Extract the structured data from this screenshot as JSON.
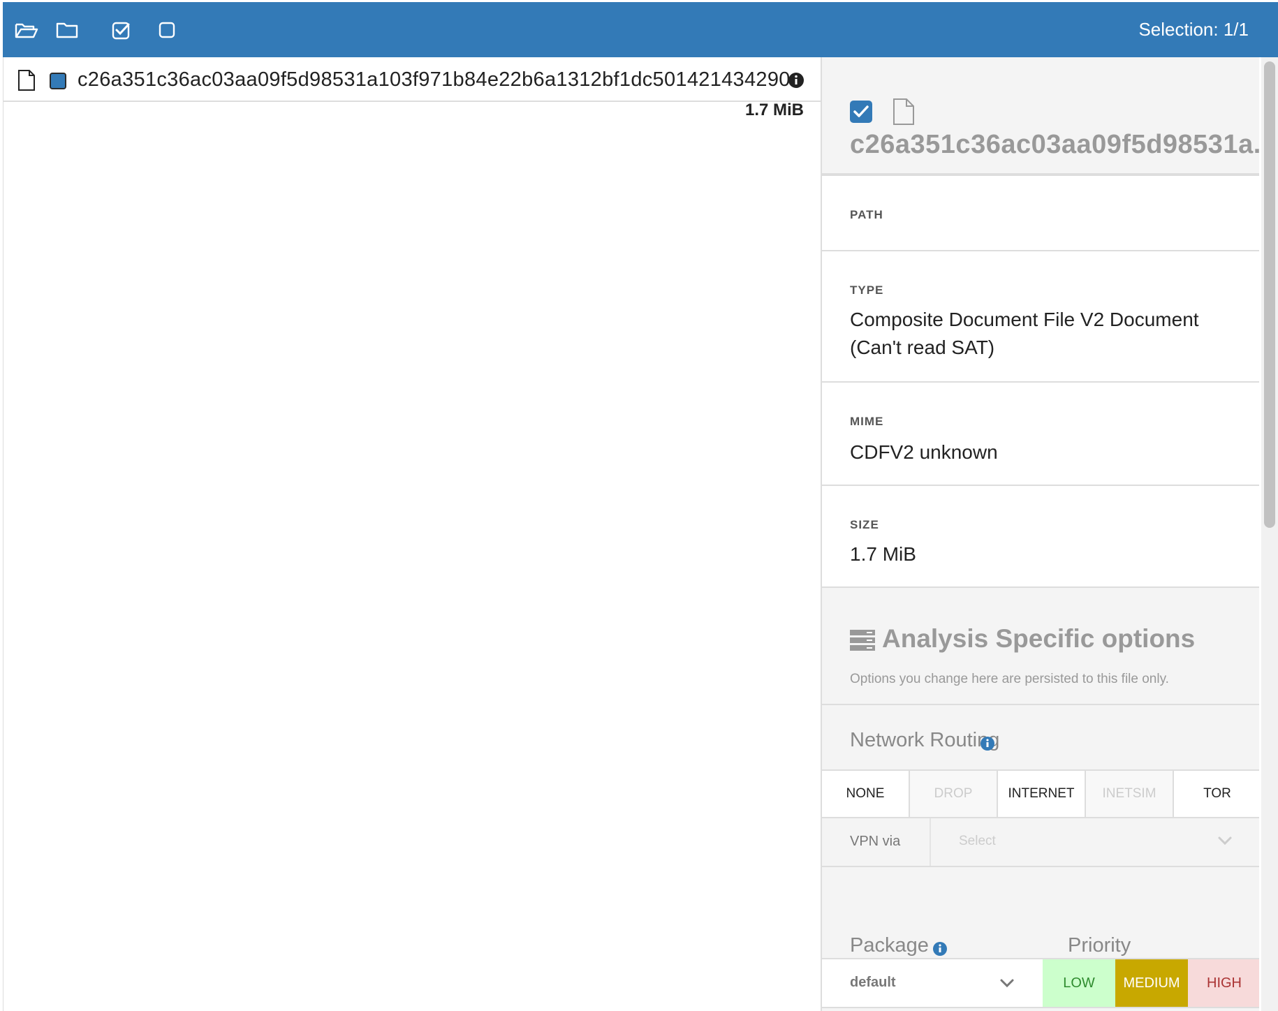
{
  "toolbar": {
    "icons": [
      "folder-open-icon",
      "folder-icon",
      "check-square-icon",
      "square-icon"
    ],
    "selection_label": "Selection: 1/1",
    "bg_color": "#337ab7"
  },
  "file_list": {
    "items": [
      {
        "name": "c26a351c36ac03aa09f5d98531a103f971b84e22b6a1312bf1dc501421434290",
        "size": "1.7 MiB",
        "selected": true
      }
    ]
  },
  "details": {
    "title": "c26a351c36ac03aa09f5d98531a...",
    "path_label": "PATH",
    "path_value": "",
    "type_label": "TYPE",
    "type_value": "Composite Document File V2 Document (Can't read SAT)",
    "mime_label": "MIME",
    "mime_value": "CDFV2 unknown",
    "size_label": "SIZE",
    "size_value": "1.7 MiB"
  },
  "analysis": {
    "title": "Analysis Specific options",
    "subtitle": "Options you change here are persisted to this file only."
  },
  "network_routing": {
    "title": "Network Routing",
    "options": [
      {
        "label": "NONE",
        "enabled": true
      },
      {
        "label": "DROP",
        "enabled": false
      },
      {
        "label": "INTERNET",
        "enabled": true
      },
      {
        "label": "INETSIM",
        "enabled": false
      },
      {
        "label": "TOR",
        "enabled": true
      }
    ],
    "vpn_label": "VPN via",
    "vpn_placeholder": "Select"
  },
  "package": {
    "title": "Package",
    "value": "default"
  },
  "priority": {
    "title": "Priority",
    "low": "LOW",
    "medium": "MEDIUM",
    "high": "HIGH",
    "selected": "MEDIUM",
    "colors": {
      "low": "#ccffcc",
      "medium": "#c8a800",
      "high": "#f7dada"
    }
  }
}
